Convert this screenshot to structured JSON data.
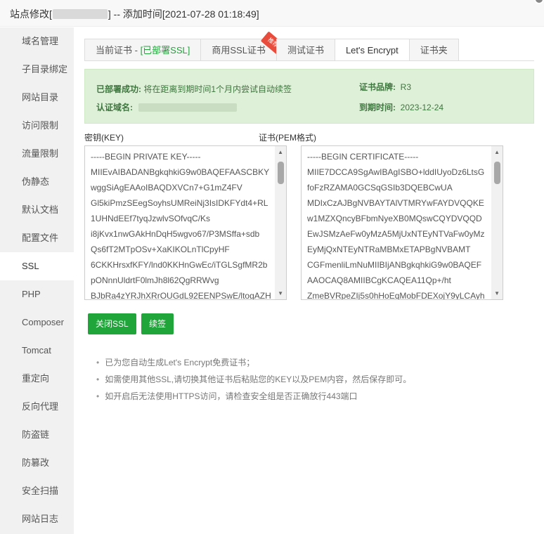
{
  "title": {
    "prefix": "站点修改[",
    "suffix": "] -- 添加时间[2021-07-28 01:18:49]"
  },
  "sidebar": {
    "items": [
      {
        "label": "域名管理"
      },
      {
        "label": "子目录绑定"
      },
      {
        "label": "网站目录"
      },
      {
        "label": "访问限制"
      },
      {
        "label": "流量限制"
      },
      {
        "label": "伪静态"
      },
      {
        "label": "默认文档"
      },
      {
        "label": "配置文件"
      },
      {
        "label": "SSL"
      },
      {
        "label": "PHP"
      },
      {
        "label": "Composer"
      },
      {
        "label": "Tomcat"
      },
      {
        "label": "重定向"
      },
      {
        "label": "反向代理"
      },
      {
        "label": "防盗链"
      },
      {
        "label": "防篡改"
      },
      {
        "label": "安全扫描"
      },
      {
        "label": "网站日志"
      }
    ],
    "active": "SSL"
  },
  "tabs": {
    "current": "当前证书 - ",
    "current_status": "[已部署SSL]",
    "commercial": "商用SSL证书",
    "commercial_badge": "推荐",
    "test": "测试证书",
    "letsencrypt": "Let's Encrypt",
    "folder": "证书夹"
  },
  "notice": {
    "deployed_label": "已部署成功:",
    "deployed_text": "将在距离到期时间1个月内尝试自动续签",
    "domain_label": "认证域名:",
    "brand_label": "证书品牌:",
    "brand_value": "R3",
    "expire_label": "到期时间:",
    "expire_value": "2023-12-24"
  },
  "key": {
    "label": "密钥(KEY)",
    "content": "-----BEGIN PRIVATE KEY-----\nMIIEvAIBADANBgkqhkiG9w0BAQEFAASCBKY\nwggSiAgEAAoIBAQDXVCn7+G1mZ4FV\nGl5kiPmzSEegSoyhsUMReiNj3IsIDKFYdt4+RL\n1UHNdEEf7tyqJzwlvSOfvqC/Ks\ni8jKvx1nwGAkHnDqH5wgvo67/P3MSffa+sdb\nQs6fT2MTpOSv+XaKIKOLnTlCpyHF\n6CKKHrsxfKFY/lnd0KKHnGwEc/iTGLSgfMR2b\npONnnUldrtF0lmJh8l62QgRRWvg\nBJbRa4zYRJhXRrOUGdL92EENPSwE/ltogAZH"
  },
  "cert": {
    "label": "证书(PEM格式)",
    "content": "-----BEGIN CERTIFICATE-----\nMIIE7DCCA9SgAwIBAgISBO+lddIUyoDz6LtsG\nfoFzRZAMA0GCSqGSIb3DQEBCwUA\nMDIxCzAJBgNVBAYTAlVTMRYwFAYDVQQKE\nw1MZXQncyBFbmNyeXB0MQswCQYDVQQD\nEwJSMzAeFw0yMzA5MjUxNTEyNTVaFw0yMz\nEyMjQxNTEyNTRaMBMxETAPBgNVBAMT\nCGFmenliLmNuMIIBIjANBgkqhkiG9w0BAQEF\nAAOCAQ8AMIIBCgKCAQEA11Qp+/ht\nZmeBVRpeZIj5s0hHoEqMobFDEXojY9yLCAyh"
  },
  "buttons": {
    "close_ssl": "关闭SSL",
    "renew": "续签"
  },
  "tips": [
    "已为您自动生成Let's Encrypt免费证书；",
    "如需使用其他SSL,请切换其他证书后粘贴您的KEY以及PEM内容，然后保存即可。",
    "如开启后无法使用HTTPS访问，请检查安全组是否正确放行443端口"
  ],
  "colors": {
    "accent": "#20a53a",
    "notice_bg": "#dff0d8",
    "notice_text": "#3c763d"
  }
}
